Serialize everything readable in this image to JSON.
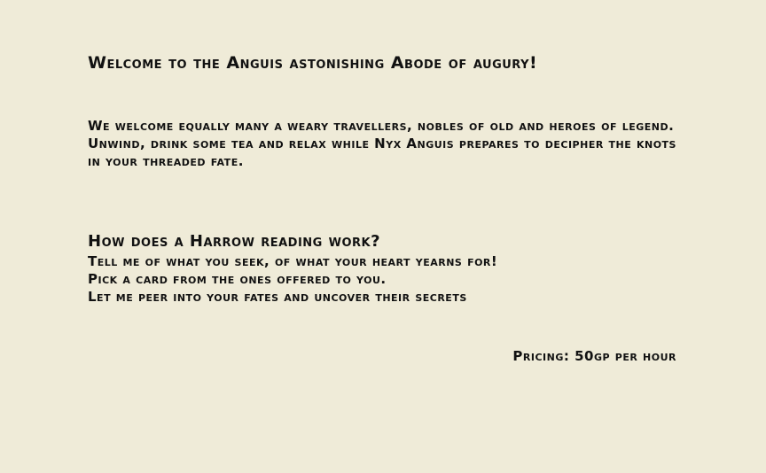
{
  "header": {
    "title": "Welcome to the Anguis astonishing Abode of augury!"
  },
  "intro": {
    "line1": "We welcome equally many a weary travellers, nobles of old and heroes of legend.",
    "line2": "Unwind, drink some tea and relax while Nyx Anguis prepares to decipher the knots in your threaded fate."
  },
  "how": {
    "heading": "How does a Harrow reading work?",
    "steps": [
      "Tell me of what you seek, of what your heart yearns for!",
      "Pick a card from the ones offered to you.",
      "Let me peer into your fates and uncover their secrets"
    ]
  },
  "pricing": {
    "text": "Pricing: 50gp per hour"
  },
  "colors": {
    "background": "#efebd8",
    "text": "#111111"
  }
}
